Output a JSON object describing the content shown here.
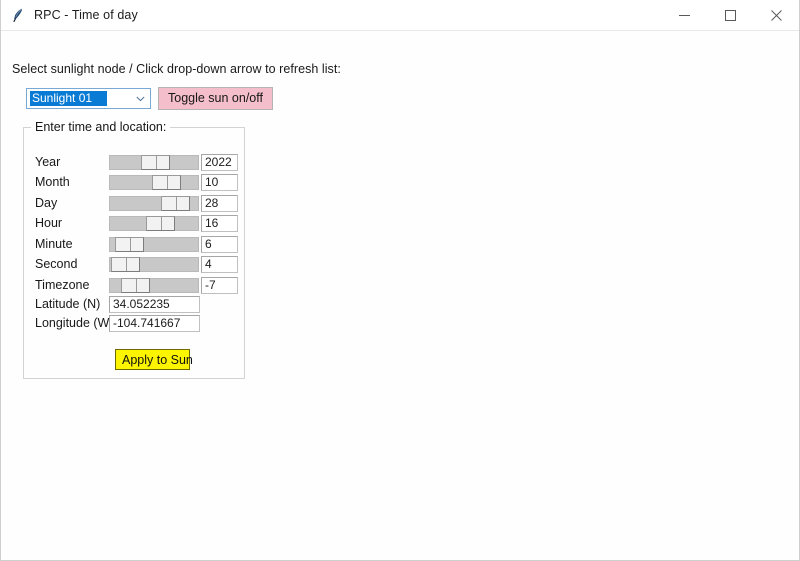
{
  "window": {
    "title": "RPC - Time of day",
    "icon": "tk-feather-icon",
    "controls": {
      "minimize": "minimize-icon",
      "maximize": "maximize-icon",
      "close": "close-icon"
    }
  },
  "hint": "Select sunlight node / Click drop-down arrow to refresh list:",
  "node_select": {
    "value": "Sunlight 01",
    "placeholder": "Sunlight 01",
    "caret_icon": "chevron-down-icon",
    "selection_bg": "#0a7bd4",
    "selection_fg": "#ffffff",
    "border_color": "#7aa8d4"
  },
  "toggle_sun": {
    "label": "Toggle sun on/off",
    "bg": "#f4bfca"
  },
  "groupbox": {
    "title": "Enter time and location:"
  },
  "fields": [
    {
      "label": "Year",
      "value": "2022",
      "type": "slider",
      "slider_pct": 55
    },
    {
      "label": "Month",
      "value": "10",
      "type": "slider",
      "slider_pct": 73
    },
    {
      "label": "Day",
      "value": "28",
      "type": "slider",
      "slider_pct": 88
    },
    {
      "label": "Hour",
      "value": "16",
      "type": "slider",
      "slider_pct": 62
    },
    {
      "label": "Minute",
      "value": "6",
      "type": "slider",
      "slider_pct": 10
    },
    {
      "label": "Second",
      "value": "4",
      "type": "slider",
      "slider_pct": 4
    },
    {
      "label": "Timezone",
      "value": "-7",
      "type": "slider",
      "slider_pct": 20
    },
    {
      "label": "Latitude (N)",
      "value": "34.052235",
      "type": "text"
    },
    {
      "label": "Longitude (W)",
      "value": "-104.741667",
      "type": "text"
    }
  ],
  "apply": {
    "label": "Apply to Sun",
    "bg": "#fdf500"
  }
}
